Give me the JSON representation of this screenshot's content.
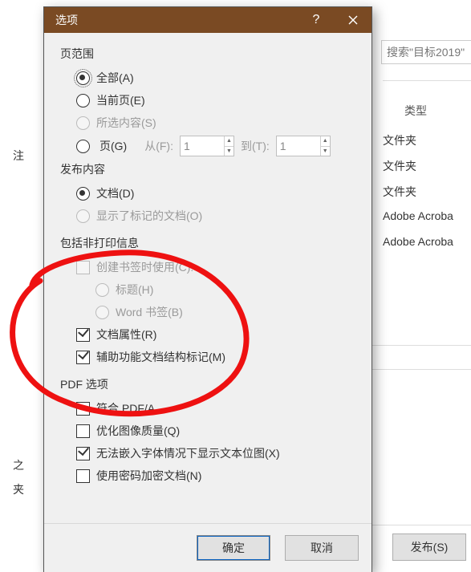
{
  "background": {
    "search_placeholder": "搜索\"目标2019\"",
    "type_header": "类型",
    "rows": [
      "文件夹",
      "文件夹",
      "文件夹",
      "Adobe Acroba",
      "Adobe Acroba"
    ],
    "left_frags": [
      "注",
      "之",
      "夹"
    ],
    "publish_label": "发布(S)"
  },
  "dialog": {
    "title": "选项",
    "sections": {
      "page_range": {
        "title": "页范围",
        "all": "全部(A)",
        "current": "当前页(E)",
        "selection": "所选内容(S)",
        "pages": "页(G)",
        "from_label": "从(F):",
        "from_value": "1",
        "to_label": "到(T):",
        "to_value": "1"
      },
      "publish_what": {
        "title": "发布内容",
        "document": "文档(D)",
        "markup": "显示了标记的文档(O)"
      },
      "nonprint": {
        "title": "包括非打印信息",
        "create_bookmarks": "创建书签时使用(C):",
        "headings": "标题(H)",
        "word_bookmarks": "Word 书签(B)",
        "doc_props": "文档属性(R)",
        "accessibility": "辅助功能文档结构标记(M)"
      },
      "pdf_options": {
        "title": "PDF 选项",
        "pdfa": "符合 PDF/A",
        "image_quality": "优化图像质量(Q)",
        "bitmap": "无法嵌入字体情况下显示文本位图(X)",
        "encrypt": "使用密码加密文档(N)"
      }
    },
    "buttons": {
      "ok": "确定",
      "cancel": "取消"
    }
  }
}
